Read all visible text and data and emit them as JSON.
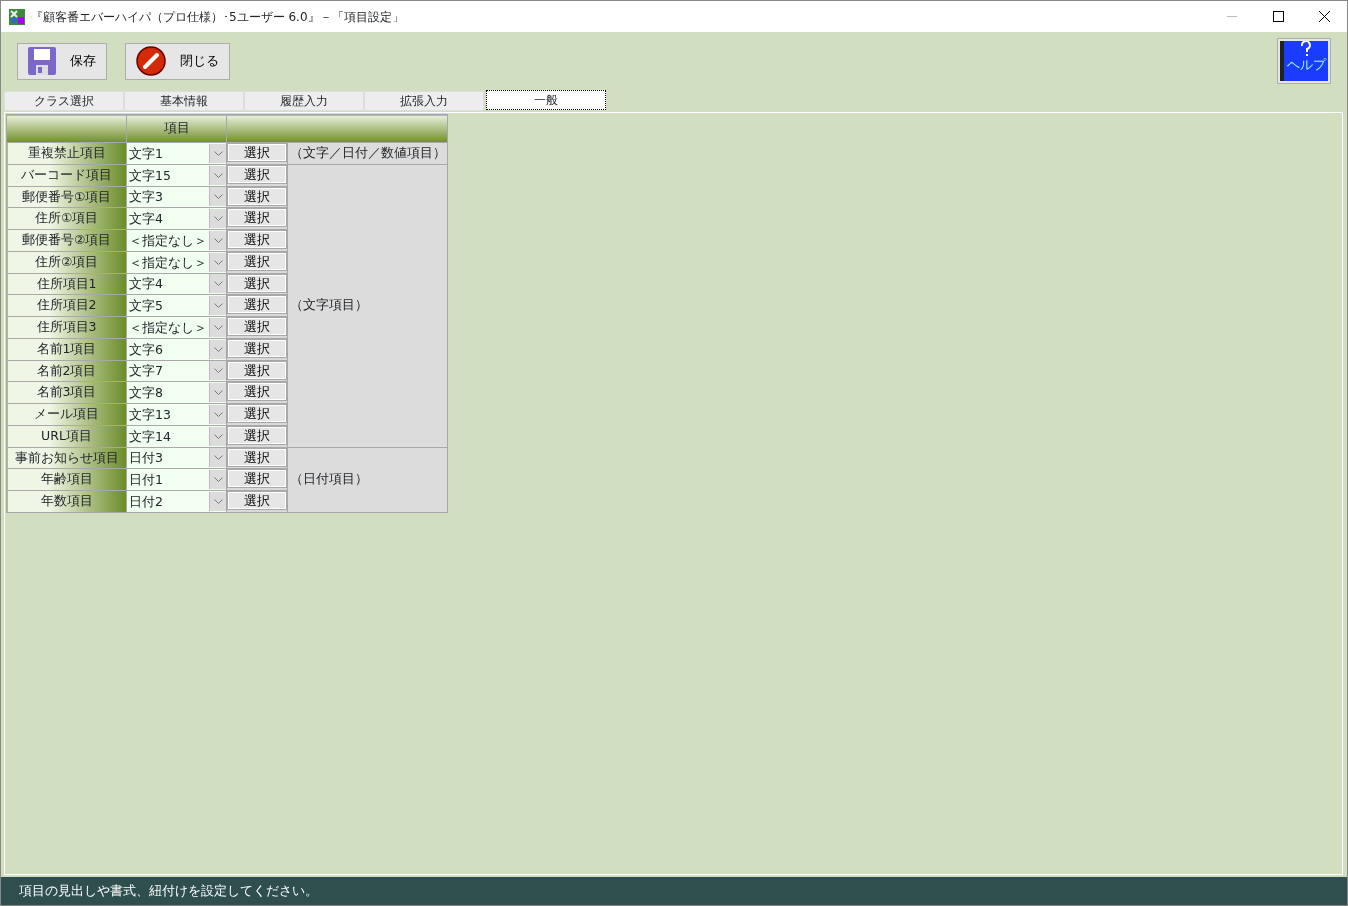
{
  "window": {
    "title": "『顧客番エバーハイパ（プロ仕様）･5ユーザー 6.0』－「項目設定」"
  },
  "toolbar": {
    "buttons": [
      {
        "kind": "save",
        "label": "保存"
      },
      {
        "kind": "close",
        "label": "閉じる"
      }
    ],
    "help_label": "ヘルプ"
  },
  "tabs": [
    {
      "label": "クラス選択",
      "selected": false
    },
    {
      "label": "基本情報",
      "selected": false
    },
    {
      "label": "履歴入力",
      "selected": false
    },
    {
      "label": "拡張入力",
      "selected": false
    },
    {
      "label": "一般",
      "selected": true
    }
  ],
  "table": {
    "columns": [
      "項目"
    ],
    "groups": [
      {
        "note": "（文字／日付／数値項目）",
        "rows": [
          {
            "label": "重複禁止項目",
            "value": "文字1",
            "button": "選択"
          }
        ]
      },
      {
        "note": "（文字項目）",
        "rows": [
          {
            "label": "バーコード項目",
            "value": "文字15",
            "button": "選択"
          },
          {
            "label": "郵便番号①項目",
            "value": "文字3",
            "button": "選択"
          },
          {
            "label": "住所①項目",
            "value": "文字4",
            "button": "選択"
          },
          {
            "label": "郵便番号②項目",
            "value": "＜指定なし＞",
            "button": "選択"
          },
          {
            "label": "住所②項目",
            "value": "＜指定なし＞",
            "button": "選択"
          },
          {
            "label": "住所項目1",
            "value": "文字4",
            "button": "選択"
          },
          {
            "label": "住所項目2",
            "value": "文字5",
            "button": "選択"
          },
          {
            "label": "住所項目3",
            "value": "＜指定なし＞",
            "button": "選択"
          },
          {
            "label": "名前1項目",
            "value": "文字6",
            "button": "選択"
          },
          {
            "label": "名前2項目",
            "value": "文字7",
            "button": "選択"
          },
          {
            "label": "名前3項目",
            "value": "文字8",
            "button": "選択"
          },
          {
            "label": "メール項目",
            "value": "文字13",
            "button": "選択"
          },
          {
            "label": "URL項目",
            "value": "文字14",
            "button": "選択"
          }
        ]
      },
      {
        "note": "（日付項目）",
        "rows": [
          {
            "label": "事前お知らせ項目",
            "value": "日付3",
            "button": "選択"
          },
          {
            "label": "年齢項目",
            "value": "日付1",
            "button": "選択"
          },
          {
            "label": "年数項目",
            "value": "日付2",
            "button": "選択"
          }
        ]
      }
    ]
  },
  "status_bar": "項目の見出しや書式、紐付けを設定してください。"
}
